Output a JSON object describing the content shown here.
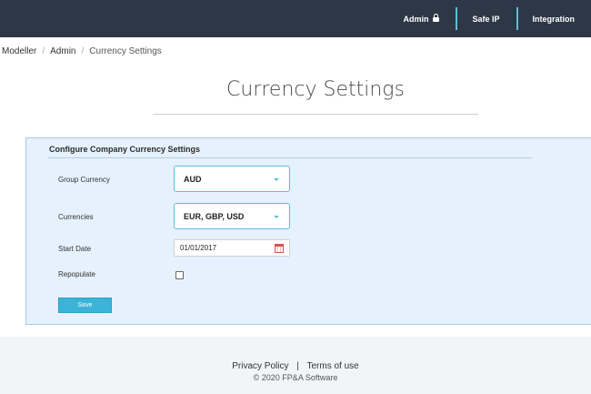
{
  "topnav": {
    "admin": "Admin",
    "safe_ip": "Safe IP",
    "integration": "Integration"
  },
  "breadcrumb": {
    "items": [
      "Modeller",
      "Admin"
    ],
    "current": "Currency Settings"
  },
  "page": {
    "title": "Currency Settings"
  },
  "form": {
    "title": "Configure Company Currency Settings",
    "group_currency_label": "Group Currency",
    "group_currency_value": "AUD",
    "currencies_label": "Currencies",
    "currencies_value": "EUR, GBP, USD",
    "start_date_label": "Start Date",
    "start_date_value": "01/01/2017",
    "repopulate_label": "Repopulate",
    "repopulate_checked": false,
    "save_label": "Save"
  },
  "footer": {
    "privacy": "Privacy Policy",
    "separator": "|",
    "terms": "Terms of use",
    "copyright": "© 2020 FP&A Software"
  },
  "colors": {
    "topbar": "#2e3745",
    "accent": "#5bbfd8",
    "panel_bg": "#e5f1fd",
    "button": "#3cb3d8"
  },
  "icons": {
    "admin": "lock-icon",
    "dropdown": "chevron-down-icon",
    "date": "calendar-icon"
  }
}
